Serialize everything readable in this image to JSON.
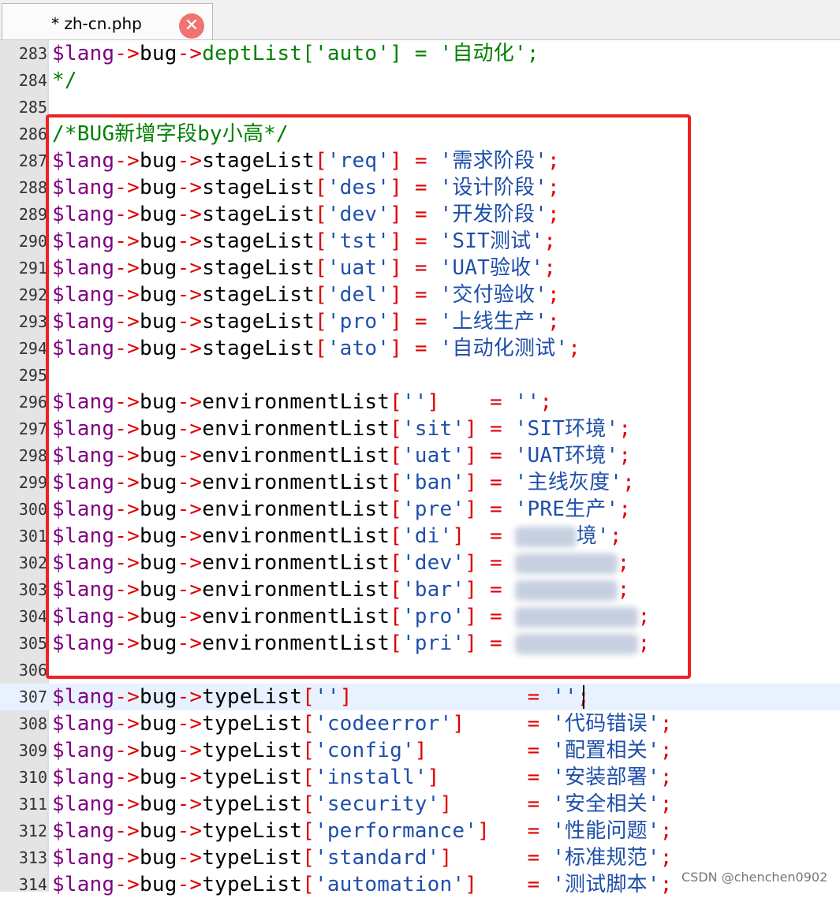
{
  "tab": {
    "title": "* zh-cn.php",
    "close_icon": "close-icon",
    "close_glyph": "✕"
  },
  "lines": [
    {
      "n": "283",
      "t": [
        [
          "var",
          "$lang"
        ],
        [
          "op",
          "->"
        ],
        [
          "prop",
          "bug"
        ],
        [
          "op",
          "->"
        ],
        [
          "cmt",
          "deptList['auto'] = '自动化';"
        ]
      ]
    },
    {
      "n": "284",
      "t": [
        [
          "cmt",
          "*/"
        ]
      ]
    },
    {
      "n": "285",
      "t": []
    },
    {
      "n": "286",
      "t": [
        [
          "cmt",
          "/*BUG新增字段by小高*/"
        ]
      ]
    },
    {
      "n": "287",
      "t": [
        [
          "var",
          "$lang"
        ],
        [
          "op",
          "->"
        ],
        [
          "prop",
          "bug"
        ],
        [
          "op",
          "->"
        ],
        [
          "prop",
          "stageList"
        ],
        [
          "br",
          "["
        ],
        [
          "str",
          "'req'"
        ],
        [
          "br",
          "]"
        ],
        [
          "op",
          " = "
        ],
        [
          "str",
          "'需求阶段'"
        ],
        [
          "br",
          ";"
        ]
      ]
    },
    {
      "n": "288",
      "t": [
        [
          "var",
          "$lang"
        ],
        [
          "op",
          "->"
        ],
        [
          "prop",
          "bug"
        ],
        [
          "op",
          "->"
        ],
        [
          "prop",
          "stageList"
        ],
        [
          "br",
          "["
        ],
        [
          "str",
          "'des'"
        ],
        [
          "br",
          "]"
        ],
        [
          "op",
          " = "
        ],
        [
          "str",
          "'设计阶段'"
        ],
        [
          "br",
          ";"
        ]
      ]
    },
    {
      "n": "289",
      "t": [
        [
          "var",
          "$lang"
        ],
        [
          "op",
          "->"
        ],
        [
          "prop",
          "bug"
        ],
        [
          "op",
          "->"
        ],
        [
          "prop",
          "stageList"
        ],
        [
          "br",
          "["
        ],
        [
          "str",
          "'dev'"
        ],
        [
          "br",
          "]"
        ],
        [
          "op",
          " = "
        ],
        [
          "str",
          "'开发阶段'"
        ],
        [
          "br",
          ";"
        ]
      ]
    },
    {
      "n": "290",
      "t": [
        [
          "var",
          "$lang"
        ],
        [
          "op",
          "->"
        ],
        [
          "prop",
          "bug"
        ],
        [
          "op",
          "->"
        ],
        [
          "prop",
          "stageList"
        ],
        [
          "br",
          "["
        ],
        [
          "str",
          "'tst'"
        ],
        [
          "br",
          "]"
        ],
        [
          "op",
          " = "
        ],
        [
          "str",
          "'SIT测试'"
        ],
        [
          "br",
          ";"
        ]
      ]
    },
    {
      "n": "291",
      "t": [
        [
          "var",
          "$lang"
        ],
        [
          "op",
          "->"
        ],
        [
          "prop",
          "bug"
        ],
        [
          "op",
          "->"
        ],
        [
          "prop",
          "stageList"
        ],
        [
          "br",
          "["
        ],
        [
          "str",
          "'uat'"
        ],
        [
          "br",
          "]"
        ],
        [
          "op",
          " = "
        ],
        [
          "str",
          "'UAT验收'"
        ],
        [
          "br",
          ";"
        ]
      ]
    },
    {
      "n": "292",
      "t": [
        [
          "var",
          "$lang"
        ],
        [
          "op",
          "->"
        ],
        [
          "prop",
          "bug"
        ],
        [
          "op",
          "->"
        ],
        [
          "prop",
          "stageList"
        ],
        [
          "br",
          "["
        ],
        [
          "str",
          "'del'"
        ],
        [
          "br",
          "]"
        ],
        [
          "op",
          " = "
        ],
        [
          "str",
          "'交付验收'"
        ],
        [
          "br",
          ";"
        ]
      ]
    },
    {
      "n": "293",
      "t": [
        [
          "var",
          "$lang"
        ],
        [
          "op",
          "->"
        ],
        [
          "prop",
          "bug"
        ],
        [
          "op",
          "->"
        ],
        [
          "prop",
          "stageList"
        ],
        [
          "br",
          "["
        ],
        [
          "str",
          "'pro'"
        ],
        [
          "br",
          "]"
        ],
        [
          "op",
          " = "
        ],
        [
          "str",
          "'上线生产'"
        ],
        [
          "br",
          ";"
        ]
      ]
    },
    {
      "n": "294",
      "t": [
        [
          "var",
          "$lang"
        ],
        [
          "op",
          "->"
        ],
        [
          "prop",
          "bug"
        ],
        [
          "op",
          "->"
        ],
        [
          "prop",
          "stageList"
        ],
        [
          "br",
          "["
        ],
        [
          "str",
          "'ato'"
        ],
        [
          "br",
          "]"
        ],
        [
          "op",
          " = "
        ],
        [
          "str",
          "'自动化测试'"
        ],
        [
          "br",
          ";"
        ]
      ]
    },
    {
      "n": "295",
      "t": []
    },
    {
      "n": "296",
      "t": [
        [
          "var",
          "$lang"
        ],
        [
          "op",
          "->"
        ],
        [
          "prop",
          "bug"
        ],
        [
          "op",
          "->"
        ],
        [
          "prop",
          "environmentList"
        ],
        [
          "br",
          "["
        ],
        [
          "str",
          "''"
        ],
        [
          "br",
          "]"
        ],
        [
          "op",
          "    = "
        ],
        [
          "str",
          "''"
        ],
        [
          "br",
          ";"
        ]
      ]
    },
    {
      "n": "297",
      "t": [
        [
          "var",
          "$lang"
        ],
        [
          "op",
          "->"
        ],
        [
          "prop",
          "bug"
        ],
        [
          "op",
          "->"
        ],
        [
          "prop",
          "environmentList"
        ],
        [
          "br",
          "["
        ],
        [
          "str",
          "'sit'"
        ],
        [
          "br",
          "]"
        ],
        [
          "op",
          " = "
        ],
        [
          "str",
          "'SIT环境'"
        ],
        [
          "br",
          ";"
        ]
      ]
    },
    {
      "n": "298",
      "t": [
        [
          "var",
          "$lang"
        ],
        [
          "op",
          "->"
        ],
        [
          "prop",
          "bug"
        ],
        [
          "op",
          "->"
        ],
        [
          "prop",
          "environmentList"
        ],
        [
          "br",
          "["
        ],
        [
          "str",
          "'uat'"
        ],
        [
          "br",
          "]"
        ],
        [
          "op",
          " = "
        ],
        [
          "str",
          "'UAT环境'"
        ],
        [
          "br",
          ";"
        ]
      ]
    },
    {
      "n": "299",
      "t": [
        [
          "var",
          "$lang"
        ],
        [
          "op",
          "->"
        ],
        [
          "prop",
          "bug"
        ],
        [
          "op",
          "->"
        ],
        [
          "prop",
          "environmentList"
        ],
        [
          "br",
          "["
        ],
        [
          "str",
          "'ban'"
        ],
        [
          "br",
          "]"
        ],
        [
          "op",
          " = "
        ],
        [
          "str",
          "'主线灰度'"
        ],
        [
          "br",
          ";"
        ]
      ]
    },
    {
      "n": "300",
      "t": [
        [
          "var",
          "$lang"
        ],
        [
          "op",
          "->"
        ],
        [
          "prop",
          "bug"
        ],
        [
          "op",
          "->"
        ],
        [
          "prop",
          "environmentList"
        ],
        [
          "br",
          "["
        ],
        [
          "str",
          "'pre'"
        ],
        [
          "br",
          "]"
        ],
        [
          "op",
          " = "
        ],
        [
          "str",
          "'PRE生产'"
        ],
        [
          "br",
          ";"
        ]
      ]
    },
    {
      "n": "301",
      "t": [
        [
          "var",
          "$lang"
        ],
        [
          "op",
          "->"
        ],
        [
          "prop",
          "bug"
        ],
        [
          "op",
          "->"
        ],
        [
          "prop",
          "environmentList"
        ],
        [
          "br",
          "["
        ],
        [
          "str",
          "'di'"
        ],
        [
          "br",
          "]"
        ],
        [
          "op",
          "  = "
        ],
        [
          "blur",
          "3"
        ],
        [
          "str",
          "境'"
        ],
        [
          "br",
          ";"
        ]
      ]
    },
    {
      "n": "302",
      "t": [
        [
          "var",
          "$lang"
        ],
        [
          "op",
          "->"
        ],
        [
          "prop",
          "bug"
        ],
        [
          "op",
          "->"
        ],
        [
          "prop",
          "environmentList"
        ],
        [
          "br",
          "["
        ],
        [
          "str",
          "'dev'"
        ],
        [
          "br",
          "]"
        ],
        [
          "op",
          " = "
        ],
        [
          "blur",
          "5"
        ],
        [
          "br",
          ";"
        ]
      ]
    },
    {
      "n": "303",
      "t": [
        [
          "var",
          "$lang"
        ],
        [
          "op",
          "->"
        ],
        [
          "prop",
          "bug"
        ],
        [
          "op",
          "->"
        ],
        [
          "prop",
          "environmentList"
        ],
        [
          "br",
          "["
        ],
        [
          "str",
          "'bar'"
        ],
        [
          "br",
          "]"
        ],
        [
          "op",
          " = "
        ],
        [
          "blur",
          "5"
        ],
        [
          "br",
          ";"
        ]
      ]
    },
    {
      "n": "304",
      "t": [
        [
          "var",
          "$lang"
        ],
        [
          "op",
          "->"
        ],
        [
          "prop",
          "bug"
        ],
        [
          "op",
          "->"
        ],
        [
          "prop",
          "environmentList"
        ],
        [
          "br",
          "["
        ],
        [
          "str",
          "'pro'"
        ],
        [
          "br",
          "]"
        ],
        [
          "op",
          " = "
        ],
        [
          "blur",
          "6"
        ],
        [
          "br",
          ";"
        ]
      ]
    },
    {
      "n": "305",
      "t": [
        [
          "var",
          "$lang"
        ],
        [
          "op",
          "->"
        ],
        [
          "prop",
          "bug"
        ],
        [
          "op",
          "->"
        ],
        [
          "prop",
          "environmentList"
        ],
        [
          "br",
          "["
        ],
        [
          "str",
          "'pri'"
        ],
        [
          "br",
          "]"
        ],
        [
          "op",
          " = "
        ],
        [
          "blur",
          "6"
        ],
        [
          "br",
          ";"
        ]
      ]
    },
    {
      "n": "306",
      "t": []
    },
    {
      "n": "307",
      "t": [
        [
          "var",
          "$lang"
        ],
        [
          "op",
          "->"
        ],
        [
          "prop",
          "bug"
        ],
        [
          "op",
          "->"
        ],
        [
          "prop",
          "typeList"
        ],
        [
          "br",
          "["
        ],
        [
          "str",
          "''"
        ],
        [
          "br",
          "]"
        ],
        [
          "op",
          "              = "
        ],
        [
          "str",
          "''"
        ],
        [
          "br",
          ";"
        ]
      ],
      "current": true
    },
    {
      "n": "308",
      "t": [
        [
          "var",
          "$lang"
        ],
        [
          "op",
          "->"
        ],
        [
          "prop",
          "bug"
        ],
        [
          "op",
          "->"
        ],
        [
          "prop",
          "typeList"
        ],
        [
          "br",
          "["
        ],
        [
          "str",
          "'codeerror'"
        ],
        [
          "br",
          "]"
        ],
        [
          "op",
          "     = "
        ],
        [
          "str",
          "'代码错误'"
        ],
        [
          "br",
          ";"
        ]
      ]
    },
    {
      "n": "309",
      "t": [
        [
          "var",
          "$lang"
        ],
        [
          "op",
          "->"
        ],
        [
          "prop",
          "bug"
        ],
        [
          "op",
          "->"
        ],
        [
          "prop",
          "typeList"
        ],
        [
          "br",
          "["
        ],
        [
          "str",
          "'config'"
        ],
        [
          "br",
          "]"
        ],
        [
          "op",
          "        = "
        ],
        [
          "str",
          "'配置相关'"
        ],
        [
          "br",
          ";"
        ]
      ]
    },
    {
      "n": "310",
      "t": [
        [
          "var",
          "$lang"
        ],
        [
          "op",
          "->"
        ],
        [
          "prop",
          "bug"
        ],
        [
          "op",
          "->"
        ],
        [
          "prop",
          "typeList"
        ],
        [
          "br",
          "["
        ],
        [
          "str",
          "'install'"
        ],
        [
          "br",
          "]"
        ],
        [
          "op",
          "       = "
        ],
        [
          "str",
          "'安装部署'"
        ],
        [
          "br",
          ";"
        ]
      ]
    },
    {
      "n": "311",
      "t": [
        [
          "var",
          "$lang"
        ],
        [
          "op",
          "->"
        ],
        [
          "prop",
          "bug"
        ],
        [
          "op",
          "->"
        ],
        [
          "prop",
          "typeList"
        ],
        [
          "br",
          "["
        ],
        [
          "str",
          "'security'"
        ],
        [
          "br",
          "]"
        ],
        [
          "op",
          "      = "
        ],
        [
          "str",
          "'安全相关'"
        ],
        [
          "br",
          ";"
        ]
      ]
    },
    {
      "n": "312",
      "t": [
        [
          "var",
          "$lang"
        ],
        [
          "op",
          "->"
        ],
        [
          "prop",
          "bug"
        ],
        [
          "op",
          "->"
        ],
        [
          "prop",
          "typeList"
        ],
        [
          "br",
          "["
        ],
        [
          "str",
          "'performance'"
        ],
        [
          "br",
          "]"
        ],
        [
          "op",
          "   = "
        ],
        [
          "str",
          "'性能问题'"
        ],
        [
          "br",
          ";"
        ]
      ]
    },
    {
      "n": "313",
      "t": [
        [
          "var",
          "$lang"
        ],
        [
          "op",
          "->"
        ],
        [
          "prop",
          "bug"
        ],
        [
          "op",
          "->"
        ],
        [
          "prop",
          "typeList"
        ],
        [
          "br",
          "["
        ],
        [
          "str",
          "'standard'"
        ],
        [
          "br",
          "]"
        ],
        [
          "op",
          "      = "
        ],
        [
          "str",
          "'标准规范'"
        ],
        [
          "br",
          ";"
        ]
      ]
    },
    {
      "n": "314",
      "t": [
        [
          "var",
          "$lang"
        ],
        [
          "op",
          "->"
        ],
        [
          "prop",
          "bug"
        ],
        [
          "op",
          "->"
        ],
        [
          "prop",
          "typeList"
        ],
        [
          "br",
          "["
        ],
        [
          "str",
          "'automation'"
        ],
        [
          "br",
          "]"
        ],
        [
          "op",
          "    = "
        ],
        [
          "str",
          "'测试脚本'"
        ],
        [
          "br",
          ";"
        ]
      ]
    }
  ],
  "watermark": "CSDN @chenchen0902",
  "colors": {
    "variable": "#800080",
    "operator": "#e00000",
    "string": "#1f4faa",
    "comment": "#008000",
    "highlight_box": "#ee2222",
    "current_line": "#e8f2fe"
  }
}
